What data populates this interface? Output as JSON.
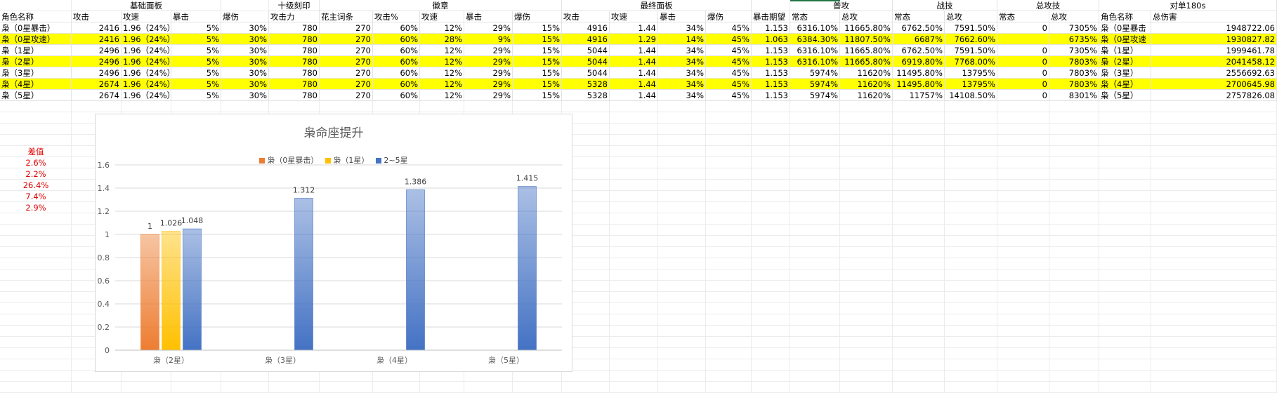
{
  "groups": [
    {
      "col": 2,
      "span": 3,
      "text": "基础面板"
    },
    {
      "col": 6,
      "span": 1,
      "text": "十级刻印"
    },
    {
      "col": 7,
      "span": 5,
      "text": "徽章"
    },
    {
      "col": 12,
      "span": 4,
      "text": "最终面板"
    },
    {
      "col": 17,
      "span": 2,
      "text": "普攻"
    },
    {
      "col": 19,
      "span": 2,
      "text": "战技"
    },
    {
      "col": 21,
      "span": 2,
      "text": "总攻技"
    },
    {
      "col": 23,
      "span": 2,
      "text": "对单180s"
    }
  ],
  "headers": [
    "角色名称",
    "攻击",
    "攻速",
    "暴击",
    "爆伤",
    "攻击力",
    "花主词条",
    "攻击%",
    "攻速",
    "暴击",
    "爆伤",
    "攻击",
    "攻速",
    "暴击",
    "爆伤",
    "暴击期望",
    "常态",
    "总攻",
    "常态",
    "总攻",
    "常态",
    "总攻",
    "角色名称",
    "总伤害"
  ],
  "rows": [
    {
      "highlight": false,
      "cells": [
        "枭（0星暴击）",
        "2416",
        "1.96（24%）",
        "5%",
        "30%",
        "780",
        "270",
        "60%",
        "12%",
        "29%",
        "15%",
        "4916",
        "1.44",
        "34%",
        "45%",
        "1.153",
        "6316.10%",
        "11665.80%",
        "6762.50%",
        "7591.50%",
        "0",
        "7305%",
        "枭（0星暴击",
        "1948722.06"
      ]
    },
    {
      "highlight": true,
      "cells": [
        "枭（0星攻速）",
        "2416",
        "1.96（24%）",
        "5%",
        "30%",
        "780",
        "270",
        "60%",
        "28%",
        "9%",
        "15%",
        "4916",
        "1.29",
        "14%",
        "45%",
        "1.063",
        "6384.30%",
        "11807.50%",
        "6687%",
        "7662.60%",
        "",
        "6735%",
        "枭（0星攻速",
        "1930827.82"
      ]
    },
    {
      "highlight": false,
      "cells": [
        "枭（1星）",
        "2496",
        "1.96（24%）",
        "5%",
        "30%",
        "780",
        "270",
        "60%",
        "12%",
        "29%",
        "15%",
        "5044",
        "1.44",
        "34%",
        "45%",
        "1.153",
        "6316.10%",
        "11665.80%",
        "6762.50%",
        "7591.50%",
        "0",
        "7305%",
        "枭（1星）",
        "1999461.78"
      ]
    },
    {
      "highlight": true,
      "cells": [
        "枭（2星）",
        "2496",
        "1.96（24%）",
        "5%",
        "30%",
        "780",
        "270",
        "60%",
        "12%",
        "29%",
        "15%",
        "5044",
        "1.44",
        "34%",
        "45%",
        "1.153",
        "6316.10%",
        "11665.80%",
        "6919.80%",
        "7768.00%",
        "0",
        "7803%",
        "枭（2星）",
        "2041458.12"
      ]
    },
    {
      "highlight": false,
      "cells": [
        "枭（3星）",
        "2496",
        "1.96（24%）",
        "5%",
        "30%",
        "780",
        "270",
        "60%",
        "12%",
        "29%",
        "15%",
        "5044",
        "1.44",
        "34%",
        "45%",
        "1.153",
        "5974%",
        "11620%",
        "11495.80%",
        "13795%",
        "0",
        "7803%",
        "枭（3星）",
        "2556692.63"
      ]
    },
    {
      "highlight": true,
      "cells": [
        "枭（4星）",
        "2674",
        "1.96（24%）",
        "5%",
        "30%",
        "780",
        "270",
        "60%",
        "12%",
        "29%",
        "15%",
        "5328",
        "1.44",
        "34%",
        "45%",
        "1.153",
        "5974%",
        "11620%",
        "11495.80%",
        "13795%",
        "0",
        "7803%",
        "枭（4星）",
        "2700645.98"
      ]
    },
    {
      "highlight": false,
      "cells": [
        "枭（5星）",
        "2674",
        "1.96（24%）",
        "5%",
        "30%",
        "780",
        "270",
        "60%",
        "12%",
        "29%",
        "15%",
        "5328",
        "1.44",
        "34%",
        "45%",
        "1.153",
        "5974%",
        "11620%",
        "11757%",
        "14108.50%",
        "0",
        "8301%",
        "枭（5星）",
        "2757826.08"
      ]
    }
  ],
  "diff": {
    "title": "差值",
    "values": [
      "2.6%",
      "2.2%",
      "26.4%",
      "7.4%",
      "2.9%"
    ]
  },
  "colors": {
    "highlight": "#ffff00",
    "diff_text": "#e00000",
    "selected_col": "#217346"
  },
  "chart_data": {
    "type": "bar",
    "title": "枭命座提升",
    "categories": [
      "枭（2星）",
      "枭（3星）",
      "枭（4星）",
      "枭（5星）"
    ],
    "series": [
      {
        "name": "枭（0星暴击）",
        "values": [
          1,
          null,
          null,
          null
        ],
        "color": "#ed7d31"
      },
      {
        "name": "枭（1星）",
        "values": [
          1.026,
          null,
          null,
          null
        ],
        "color": "#ffc000"
      },
      {
        "name": "2~5星",
        "values": [
          1.048,
          1.312,
          1.386,
          1.415
        ],
        "color": "#4472c4"
      }
    ],
    "ylim": [
      0,
      1.6
    ],
    "yticks": [
      "0",
      "0.2",
      "0.4",
      "0.6",
      "0.8",
      "1",
      "1.2",
      "1.4",
      "1.6"
    ],
    "grid": true,
    "legend": "top"
  }
}
